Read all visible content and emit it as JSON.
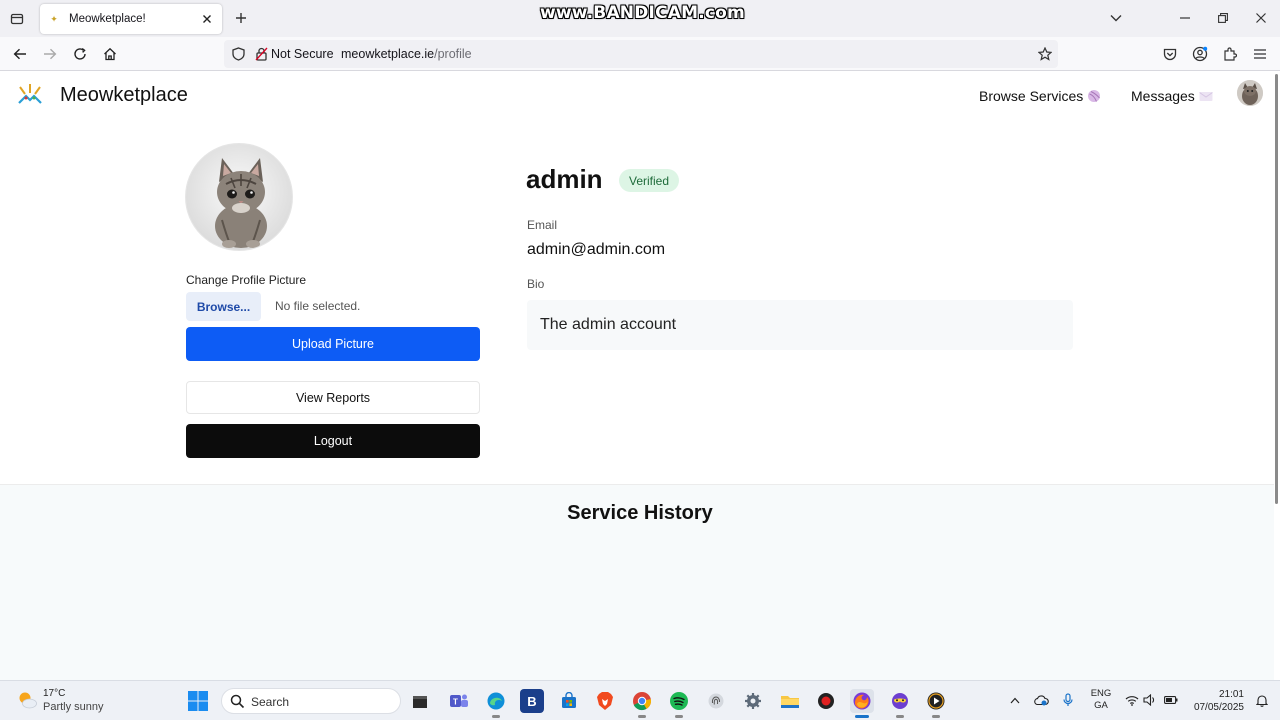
{
  "browser": {
    "tab_title": "Meowketplace!",
    "watermark": "www.BANDICAM.com",
    "security_label": "Not Secure",
    "url_domain": "meowketplace.ie",
    "url_path": "/profile"
  },
  "site": {
    "name": "Meowketplace",
    "nav": {
      "browse": "Browse Services",
      "messages": "Messages"
    }
  },
  "profile": {
    "change_picture_label": "Change Profile Picture",
    "browse_button": "Browse...",
    "no_file_text": "No file selected.",
    "upload_button": "Upload Picture",
    "reports_button": "View Reports",
    "logout_button": "Logout",
    "username": "admin",
    "badge": "Verified",
    "email_label": "Email",
    "email": "admin@admin.com",
    "bio_label": "Bio",
    "bio": "The admin account"
  },
  "history": {
    "title": "Service History"
  },
  "taskbar": {
    "temperature": "17°C",
    "weather": "Partly sunny",
    "search_placeholder": "Search",
    "lang_line1": "ENG",
    "lang_line2": "GA",
    "time": "21:01",
    "date": "07/05/2025",
    "apps": [
      "file-explorer-dark-icon",
      "teams-icon",
      "edge-icon",
      "b-app-icon",
      "store-icon",
      "brave-icon",
      "chrome-icon",
      "spotify-icon",
      "fingerprint-icon",
      "settings-icon",
      "file-explorer-icon",
      "record-icon",
      "firefox-icon",
      "vpn-mask-icon",
      "media-player-icon"
    ]
  },
  "colors": {
    "primary": "#0d5cf5",
    "logout": "#0c0c0c",
    "verified_bg": "#ddf5e5",
    "verified_text": "#1e6b3a"
  }
}
